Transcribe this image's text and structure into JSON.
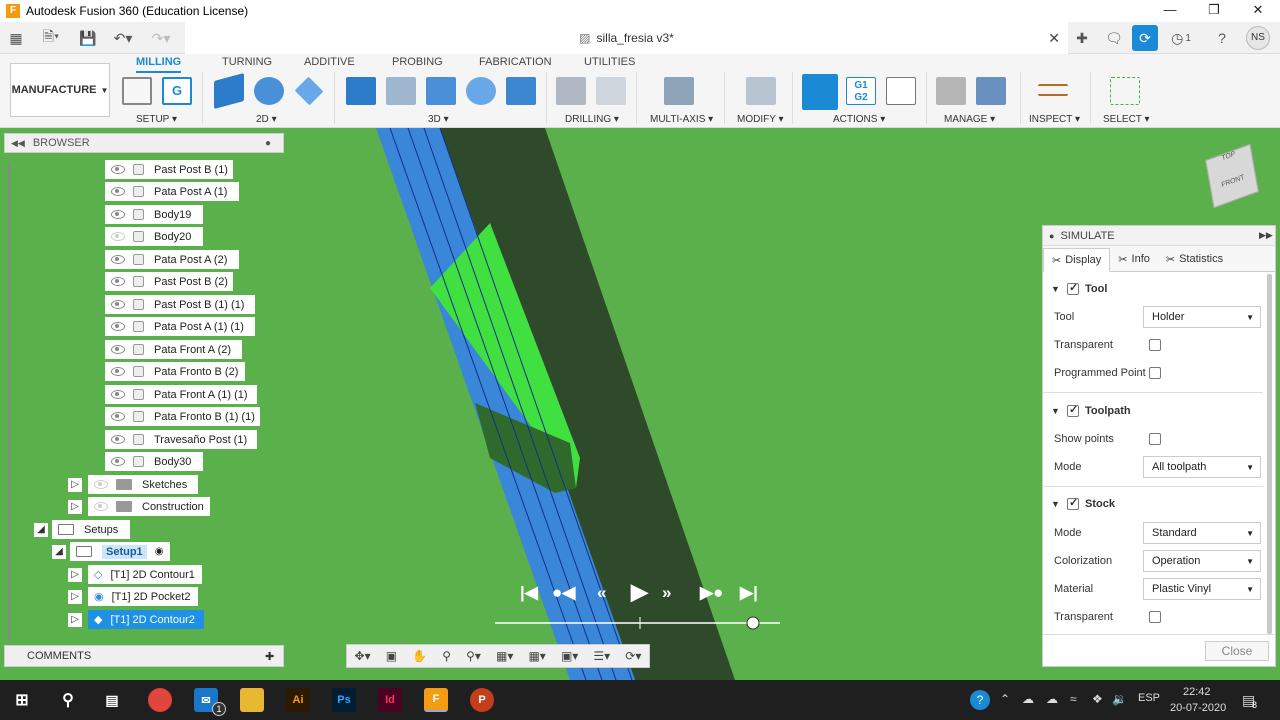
{
  "window": {
    "title": "Autodesk Fusion 360 (Education License)",
    "app_icon": "F"
  },
  "document": {
    "tab_title": "silla_fresia v3*",
    "user_initials": "NS",
    "job_count": "1"
  },
  "ribbon": {
    "workspace": "MANUFACTURE",
    "tabs": [
      "MILLING",
      "TURNING",
      "ADDITIVE",
      "PROBING",
      "FABRICATION",
      "UTILITIES"
    ],
    "active_tab": "MILLING",
    "groups": [
      "SETUP",
      "2D",
      "3D",
      "DRILLING",
      "MULTI-AXIS",
      "MODIFY",
      "ACTIONS",
      "MANAGE",
      "INSPECT",
      "SELECT"
    ],
    "actions_g1g2": "G1\nG2"
  },
  "browser": {
    "title": "BROWSER",
    "bodies": [
      "Past Post B (1)",
      "Pata Post A (1)",
      "Body19",
      "Body20",
      "Pata Post A (2)",
      "Past Post B (2)",
      "Past Post B (1) (1)",
      "Pata Post A (1) (1)",
      "Pata Front A (2)",
      "Pata Fronto B (2)",
      "Pata Front A (1) (1)",
      "Pata Fronto B (1) (1)",
      "Travesaño Post (1)",
      "Body30"
    ],
    "folders": [
      "Sketches",
      "Construction"
    ],
    "setups_label": "Setups",
    "setup1": "Setup1",
    "operations": [
      "[T1] 2D Contour1",
      "[T1] 2D Pocket2",
      "[T1] 2D Contour2"
    ],
    "selected_operation": "[T1] 2D Contour2"
  },
  "comments": {
    "title": "COMMENTS"
  },
  "viewcube": {
    "top": "TOP",
    "front": "FRONT"
  },
  "simulate": {
    "title": "SIMULATE",
    "tabs": [
      "Display",
      "Info",
      "Statistics"
    ],
    "tool_section": {
      "title": "Tool",
      "tool_label": "Tool",
      "tool_value": "Holder",
      "transparent_label": "Transparent",
      "programmed_point_label": "Programmed Point"
    },
    "toolpath_section": {
      "title": "Toolpath",
      "show_points_label": "Show points",
      "mode_label": "Mode",
      "mode_value": "All toolpath"
    },
    "stock_section": {
      "title": "Stock",
      "mode_label": "Mode",
      "mode_value": "Standard",
      "colorization_label": "Colorization",
      "colorization_value": "Operation",
      "material_label": "Material",
      "material_value": "Plastic Vinyl",
      "transparent_label": "Transparent"
    },
    "close_label": "Close",
    "playback_progress": 1.0
  },
  "taskbar": {
    "apps": [
      "Chrome",
      "Mail",
      "Explorer",
      "Ai",
      "Ps",
      "Id",
      "F",
      "P"
    ],
    "mail_badge": "1",
    "language": "ESP",
    "time": "22:42",
    "date": "20-07-2020",
    "notifications": "8"
  },
  "colors": {
    "viewport": "#5ab04a",
    "accent": "#1a8ad4",
    "selection": "#1e90e6",
    "taskbar": "#1f1f1f"
  }
}
